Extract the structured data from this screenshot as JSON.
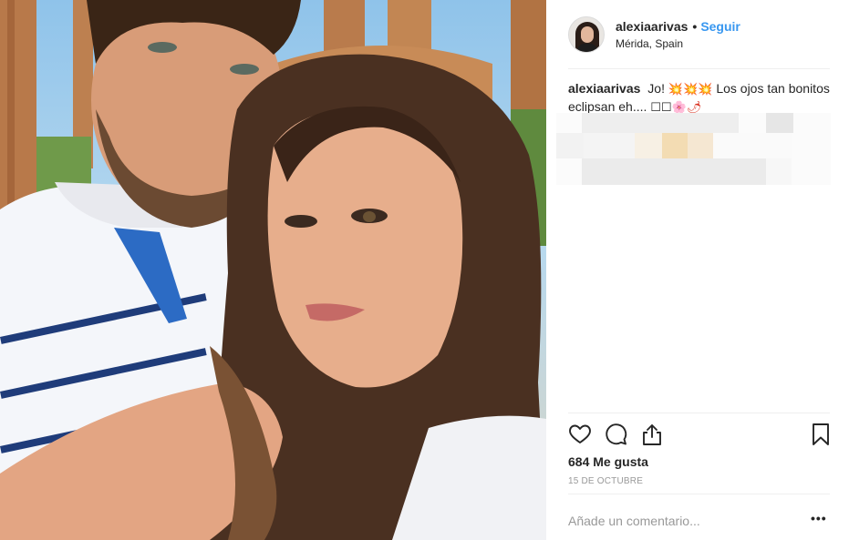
{
  "post": {
    "username": "alexiaarivas",
    "separator": "•",
    "follow_label": "Seguir",
    "location": "Mérida, Spain",
    "caption": {
      "username": "alexiaarivas",
      "text_start": "Jo!",
      "emoji_burst": "💥",
      "text_mid": "Los ojos tan bonitos eclipsan eh....",
      "emoji_boxes": "☐☐",
      "emoji_flower": "🌸",
      "emoji_pepper": "🌶"
    },
    "likes": "684 Me gusta",
    "date": "15 DE OCTUBRE",
    "comment_placeholder": "Añade un comentario...",
    "more_label": "•••"
  },
  "icons": {
    "like": "heart-icon",
    "comment": "comment-bubble-icon",
    "share": "share-icon",
    "save": "bookmark-icon",
    "more": "more-options-icon"
  },
  "colors": {
    "follow": "#3897f0",
    "text": "#262626",
    "muted": "#999999",
    "divider": "#efefef"
  }
}
